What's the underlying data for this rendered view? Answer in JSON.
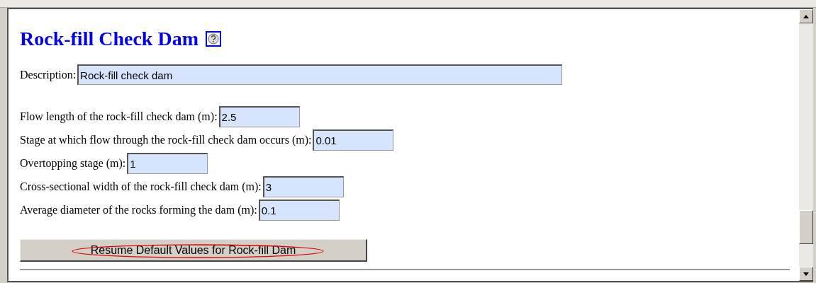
{
  "title": "Rock-fill Check Dam",
  "description": {
    "label": "Description:",
    "value": "Rock-fill check dam"
  },
  "fields": [
    {
      "label": "Flow length of the rock-fill check dam (m):",
      "value": "2.5"
    },
    {
      "label": "Stage at which flow through the rock-fill check dam occurs (m):",
      "value": "0.01"
    },
    {
      "label": "Overtopping stage (m):",
      "value": "1"
    },
    {
      "label": "Cross-sectional width of the rock-fill check dam (m):",
      "value": "3"
    },
    {
      "label": "Average diameter of the rocks forming the dam (m):",
      "value": "0.1"
    }
  ],
  "button": {
    "label": "Resume Default Values for Rock-fill Dam",
    "circled": true
  }
}
